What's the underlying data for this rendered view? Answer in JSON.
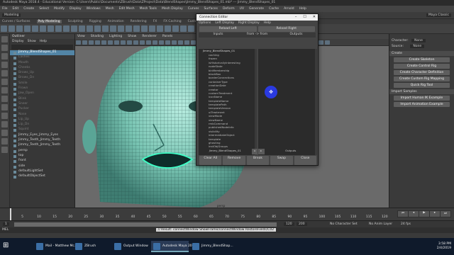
{
  "window": {
    "title": "Autodesk Maya 2018.4 - Educational Version: C:\\Users\\Public\\Documents\\ZBrush\\Data\\ZProject\\Data\\BlendShapes\\Jimmy_BlendShapes_01.mb* --- Jimmy_BlendShapes_01"
  },
  "menubar": [
    "File",
    "Edit",
    "Create",
    "Select",
    "Modify",
    "Display",
    "Windows",
    "Mesh",
    "Edit Mesh",
    "Mesh Tools",
    "Mesh Display",
    "Curves",
    "Surfaces",
    "Deform",
    "UV",
    "Generate",
    "Cache",
    "Arnold",
    "Help"
  ],
  "status": {
    "mode": "Modeling",
    "workspace": "Maya Classic"
  },
  "shelf_tabs": [
    "Curves / Surfaces",
    "Poly Modeling",
    "Sculpting",
    "Rigging",
    "Animation",
    "Rendering",
    "FX",
    "FX Caching",
    "Custom",
    "Arnold",
    "Bifrost",
    "MASH",
    "Motion Graphics",
    "XGen"
  ],
  "shelf_active": "Poly Modeling",
  "outliner": {
    "title": "Outliner",
    "menu": [
      "Display",
      "Show",
      "Help"
    ],
    "items": [
      {
        "label": "Jimmy_BlendShapes_01",
        "selected": true,
        "dim": false
      },
      {
        "label": "Lashes",
        "selected": false,
        "dim": true
      },
      {
        "label": "Mouth",
        "selected": false,
        "dim": true
      },
      {
        "label": "Cheeks",
        "selected": false,
        "dim": true
      },
      {
        "label": "Brows_Up",
        "selected": false,
        "dim": true
      },
      {
        "label": "Brows_Dn",
        "selected": false,
        "dim": true
      },
      {
        "label": "Smile",
        "selected": false,
        "dim": true
      },
      {
        "label": "Frown",
        "selected": false,
        "dim": true
      },
      {
        "label": "Jaw_Open",
        "selected": false,
        "dim": true
      },
      {
        "label": "Blink",
        "selected": false,
        "dim": true
      },
      {
        "label": "Sneer",
        "selected": false,
        "dim": true
      },
      {
        "label": "Pucker",
        "selected": false,
        "dim": true
      },
      {
        "label": "Nose",
        "selected": false,
        "dim": true
      },
      {
        "label": "Lip_Up",
        "selected": false,
        "dim": true
      },
      {
        "label": "Lip_Dn",
        "selected": false,
        "dim": true
      },
      {
        "label": "Squint",
        "selected": false,
        "dim": true
      },
      {
        "label": "Jimmy_Eyes_Jimmy_Eyes",
        "selected": false,
        "dim": false
      },
      {
        "label": "Jimmy_Teeth_Jimmy_Teeth",
        "selected": false,
        "dim": false
      },
      {
        "label": "Jimmy_Teeth_Jimmy_Teeth",
        "selected": false,
        "dim": false
      },
      {
        "label": "persp",
        "selected": false,
        "dim": false
      },
      {
        "label": "top",
        "selected": false,
        "dim": false
      },
      {
        "label": "front",
        "selected": false,
        "dim": false
      },
      {
        "label": "side",
        "selected": false,
        "dim": false
      },
      {
        "label": "defaultLightSet",
        "selected": false,
        "dim": false
      },
      {
        "label": "defaultObjectSet",
        "selected": false,
        "dim": false
      }
    ]
  },
  "viewport": {
    "menu": [
      "View",
      "Shading",
      "Lighting",
      "Show",
      "Renderer",
      "Panels"
    ],
    "camera": "persp"
  },
  "connection_editor": {
    "title": "Connection Editor",
    "menu": [
      "Options",
      "Left Display",
      "Right Display",
      "Help"
    ],
    "reload_left": "Reload Left",
    "reload_right": "Reload Right",
    "col_inputs_left": "Inputs",
    "col_mode": "from -> from",
    "col_outputs": "Outputs",
    "left_node": "Jimmy_BlendShapes_01",
    "right_node": "Outputs",
    "attributes": [
      "caching",
      "frozen",
      "isHistoricallyInteresting",
      "nodeState",
      "binMembership",
      "blackBox",
      "borderConnections",
      "containerType",
      "creationDate",
      "creator",
      "customTreatment",
      "iconName",
      "templateName",
      "templatePath",
      "templateVersion",
      "uiTreatment",
      "viewMode",
      "viewName",
      "rmbCommand",
      "publishedNodeInfo",
      "visibility",
      "intermediateObject",
      "template",
      "ghosting",
      "instObjGroups"
    ],
    "buttons": [
      "Clear All",
      "Remove",
      "Break",
      "Swap",
      "Close"
    ]
  },
  "right_panel": {
    "character_label": "Character:",
    "character_value": "None",
    "source_label": "Source:",
    "source_value": "None",
    "sections": [
      {
        "title": "Create",
        "buttons": [
          "Create Skeleton",
          "Create Control Rig",
          "Create Character Definition",
          "Create Custom Rig Mapping",
          "Quick Rig Tool"
        ]
      },
      {
        "title": "Import Samples",
        "buttons": [
          "Import Human IK Example",
          "Import Animation Example"
        ]
      }
    ]
  },
  "timeslider": {
    "ticks": [
      "5",
      "10",
      "15",
      "20",
      "25",
      "30",
      "35",
      "40",
      "45",
      "50",
      "55",
      "60",
      "65",
      "70",
      "75",
      "80",
      "85",
      "90",
      "95",
      "100",
      "105",
      "110",
      "115",
      "120"
    ],
    "current_frame": "1"
  },
  "rangeslider": {
    "start": "1",
    "end": "120",
    "anim_start": "120",
    "anim_end": "200",
    "char_set": "No Character Set",
    "anim_layer": "No Anim Layer",
    "fps": "24 fps"
  },
  "cmdline": {
    "lang": "MEL",
    "text": "// Result: connectWindow ShowFrame/connectWindow RestoreFields/C02"
  },
  "taskbar": {
    "items": [
      "Mail - Matthew Mc...",
      "ZBrush",
      "Output Window",
      "Autodesk Maya 201...",
      "Jimmy_BlendShap..."
    ],
    "active": "Autodesk Maya 201...",
    "time": "3:58 PM",
    "date": "2/4/2019"
  }
}
